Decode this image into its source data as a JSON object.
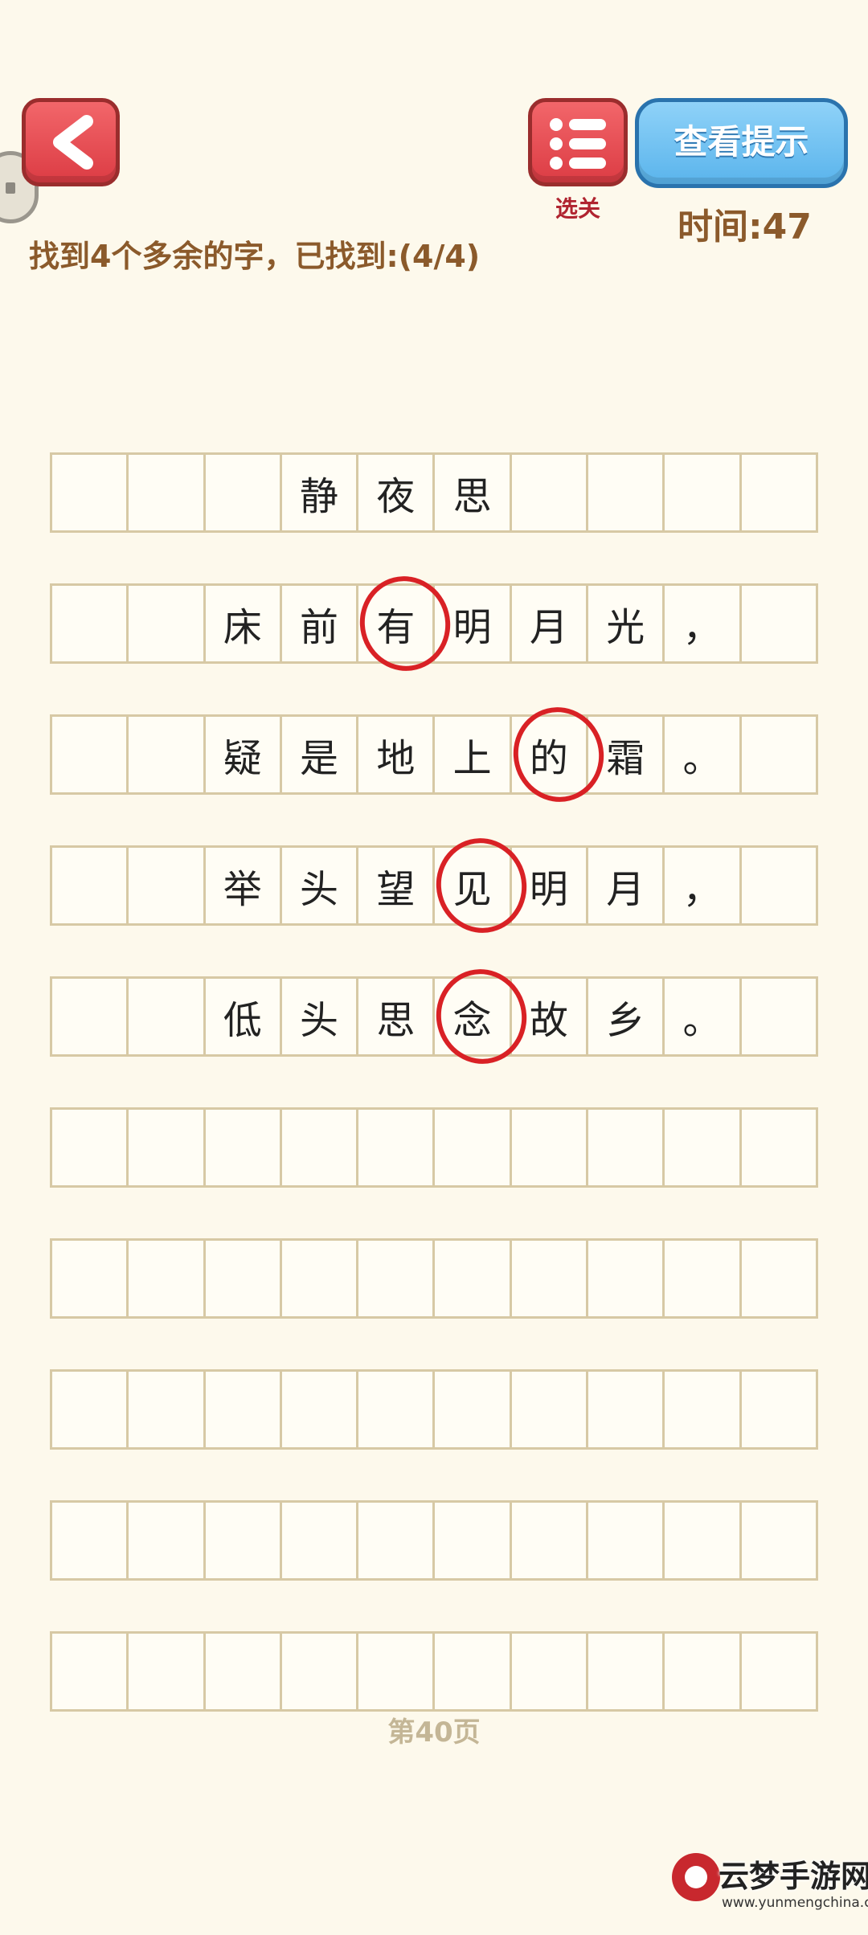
{
  "header": {
    "menu_label": "选关",
    "hint_label": "查看提示",
    "timer": "时间:47",
    "progress": "找到4个多余的字，已找到:(4/4)"
  },
  "grid": {
    "rows": [
      [
        "",
        "",
        "",
        "静",
        "夜",
        "思",
        "",
        "",
        "",
        ""
      ],
      [
        "",
        "",
        "床",
        "前",
        "有",
        "明",
        "月",
        "光",
        "，",
        ""
      ],
      [
        "",
        "",
        "疑",
        "是",
        "地",
        "上",
        "的",
        "霜",
        "。",
        ""
      ],
      [
        "",
        "",
        "举",
        "头",
        "望",
        "见",
        "明",
        "月",
        "，",
        ""
      ],
      [
        "",
        "",
        "低",
        "头",
        "思",
        "念",
        "故",
        "乡",
        "。",
        ""
      ],
      [
        "",
        "",
        "",
        "",
        "",
        "",
        "",
        "",
        "",
        ""
      ],
      [
        "",
        "",
        "",
        "",
        "",
        "",
        "",
        "",
        "",
        ""
      ],
      [
        "",
        "",
        "",
        "",
        "",
        "",
        "",
        "",
        "",
        ""
      ],
      [
        "",
        "",
        "",
        "",
        "",
        "",
        "",
        "",
        "",
        ""
      ],
      [
        "",
        "",
        "",
        "",
        "",
        "",
        "",
        "",
        "",
        ""
      ]
    ],
    "found": [
      {
        "row": 1,
        "col": 4,
        "char": "有"
      },
      {
        "row": 2,
        "col": 6,
        "char": "的"
      },
      {
        "row": 3,
        "col": 5,
        "char": "见"
      },
      {
        "row": 4,
        "col": 5,
        "char": "念"
      }
    ]
  },
  "footer": {
    "page": "第40页"
  },
  "watermark": {
    "name": "云梦手游网",
    "url": "www.yunmengchina.com"
  },
  "colors": {
    "background": "#fdf9ec",
    "accent_red": "#d92125",
    "brown_text": "#8b5a2b",
    "hint_blue": "#5ab4ec"
  }
}
